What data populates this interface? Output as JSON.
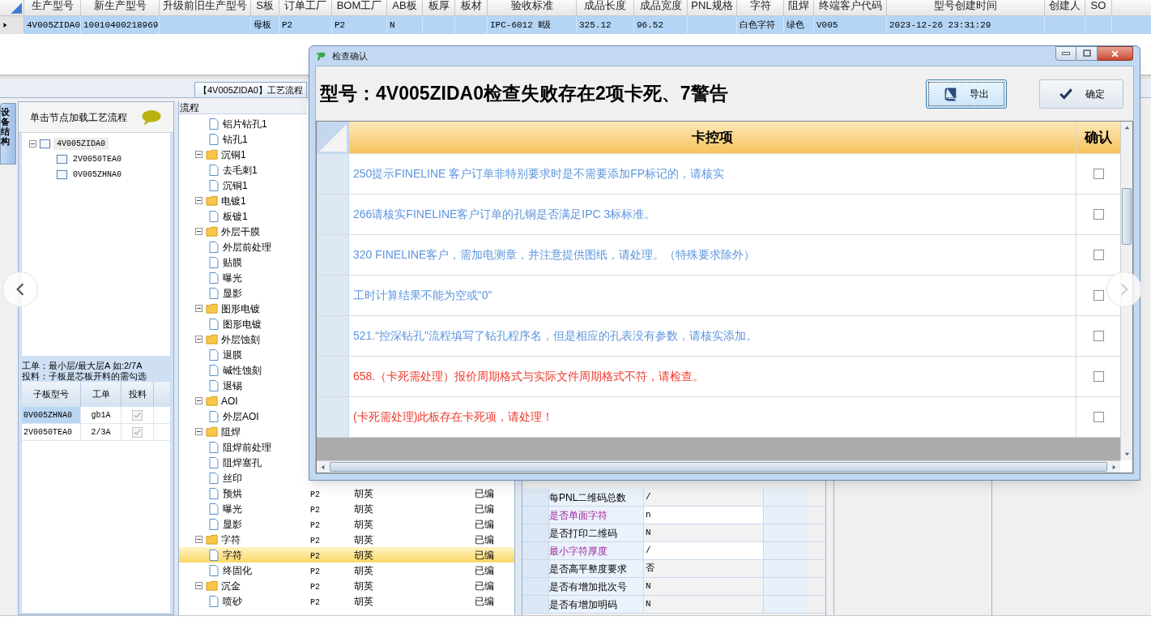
{
  "top_table": {
    "columns": [
      "生产型号",
      "新生产型号",
      "升级前旧生产型号",
      "S板",
      "订单工厂",
      "BOM工厂",
      "AB板",
      "板厚",
      "板材",
      "验收标准",
      "成品长度",
      "成品宽度",
      "PNL规格",
      "字符",
      "阻焊",
      "终端客户代码",
      "型号创建时间",
      "创建人",
      "SO"
    ],
    "rows": [
      {
        "selected": true,
        "cells": [
          "4V005ZIDA0",
          "10010400218969",
          "",
          "母板",
          "P2",
          "P2",
          "N",
          "",
          "",
          "IPC-6012 Ⅱ级",
          "325.12",
          "96.52",
          "",
          "白色字符",
          "绿色",
          "V005",
          "2023-12-26 23:31:29",
          "",
          ""
        ]
      }
    ]
  },
  "document_tab": "【4V005ZIDA0】工艺流程",
  "side_tab": "设备结构",
  "left_panel": {
    "header": "单击节点加载工艺流程",
    "tree": [
      {
        "label": "4V005ZIDA0",
        "expanded": true,
        "children": [
          {
            "label": "2V0050TEA0"
          },
          {
            "label": "0V005ZHNA0"
          }
        ]
      }
    ],
    "note": [
      "工单：最小层/最大层A 如:2/7A",
      "投料：子板是芯板开料的需勾选"
    ],
    "table": {
      "columns": [
        "子板型号",
        "工单",
        "投料"
      ],
      "rows": [
        {
          "selected": true,
          "model": "0V005ZHNA0",
          "order": "gb1A",
          "checked": true
        },
        {
          "selected": false,
          "model": "2V0050TEA0",
          "order": "2/3A",
          "checked": true
        }
      ]
    }
  },
  "flow": {
    "header": "流程",
    "items": [
      {
        "kind": "file",
        "label": "铝片钻孔1"
      },
      {
        "kind": "file",
        "label": "钻孔1"
      },
      {
        "kind": "folder",
        "label": "沉铜1",
        "expanded": true,
        "children": [
          {
            "kind": "file",
            "label": "去毛刺1"
          },
          {
            "kind": "file",
            "label": "沉铜1"
          }
        ]
      },
      {
        "kind": "folder",
        "label": "电镀1",
        "expanded": true,
        "children": [
          {
            "kind": "file",
            "label": "板镀1"
          }
        ]
      },
      {
        "kind": "folder",
        "label": "外层干膜",
        "expanded": true,
        "children": [
          {
            "kind": "file",
            "label": "外层前处理"
          },
          {
            "kind": "file",
            "label": "贴膜"
          },
          {
            "kind": "file",
            "label": "曝光"
          },
          {
            "kind": "file",
            "label": "显影"
          }
        ]
      },
      {
        "kind": "folder",
        "label": "图形电镀",
        "expanded": true,
        "children": [
          {
            "kind": "file",
            "label": "图形电镀"
          }
        ]
      },
      {
        "kind": "folder",
        "label": "外层蚀刻",
        "expanded": true,
        "children": [
          {
            "kind": "file",
            "label": "退膜"
          },
          {
            "kind": "file",
            "label": "碱性蚀刻"
          },
          {
            "kind": "file",
            "label": "退锡"
          }
        ]
      },
      {
        "kind": "folder",
        "label": "AOI",
        "expanded": true,
        "children": [
          {
            "kind": "file",
            "label": "外层AOI"
          }
        ]
      },
      {
        "kind": "folder",
        "label": "阻焊",
        "expanded": true,
        "children": [
          {
            "kind": "file",
            "label": "阻焊前处理"
          },
          {
            "kind": "file",
            "label": "阻焊塞孔"
          },
          {
            "kind": "file",
            "label": "丝印"
          },
          {
            "kind": "file",
            "label": "预烘",
            "factory": "P2",
            "person": "胡英",
            "status": "已编"
          },
          {
            "kind": "file",
            "label": "曝光",
            "factory": "P2",
            "person": "胡英",
            "status": "已编"
          },
          {
            "kind": "file",
            "label": "显影",
            "factory": "P2",
            "person": "胡英",
            "status": "已编"
          }
        ]
      },
      {
        "kind": "folder",
        "label": "字符",
        "expanded": true,
        "factory": "P2",
        "person": "胡英",
        "status": "已编",
        "children": [
          {
            "kind": "file",
            "label": "字符",
            "selected": true,
            "factory": "P2",
            "person": "胡英",
            "status": "已编"
          },
          {
            "kind": "file",
            "label": "终固化",
            "factory": "P2",
            "person": "胡英",
            "status": "已编"
          }
        ]
      },
      {
        "kind": "folder",
        "label": "沉金",
        "expanded": true,
        "factory": "P2",
        "person": "胡英",
        "status": "已编",
        "children": [
          {
            "kind": "file",
            "label": "喷砂",
            "factory": "P2",
            "person": "胡英",
            "status": "已编"
          }
        ]
      }
    ]
  },
  "params": [
    {
      "label": "每PNL二维码总数",
      "value": "/",
      "highlight": false
    },
    {
      "label": "是否单面字符",
      "value": "n",
      "highlight": true
    },
    {
      "label": "是否打印二维码",
      "value": "N",
      "highlight": false
    },
    {
      "label": "最小字符厚度",
      "value": "/",
      "highlight": true
    },
    {
      "label": "是否高平整度要求",
      "value": "否",
      "highlight": false
    },
    {
      "label": "是否有增加批次号",
      "value": "N",
      "highlight": false
    },
    {
      "label": "是否有增加明码",
      "value": "N",
      "highlight": false
    }
  ],
  "dialog": {
    "title": "检查确认",
    "heading": "型号：4V005ZIDA0检查失败存在2项卡死、7警告",
    "buttons": [
      {
        "label": "导出",
        "kind": "export"
      },
      {
        "label": "确定",
        "kind": "ok"
      }
    ],
    "columns": [
      "卡控项",
      "确认"
    ],
    "rows": [
      {
        "kind": "warning",
        "text": "250提示FINELINE 客户订单非特别要求时是不需要添加FP标记的，请核实",
        "checked": false
      },
      {
        "kind": "warning",
        "text": "266请核实FINELINE客户订单的孔铜是否满足IPC 3标标准。",
        "checked": false
      },
      {
        "kind": "warning",
        "text": "320 FINELINE客户，需加电测章，并注意提供图纸，请处理。（特殊要求除外）",
        "checked": false
      },
      {
        "kind": "warning",
        "text": "工时计算结果不能为空或“0”",
        "checked": false
      },
      {
        "kind": "warning",
        "text": "521.“控深钻孔”流程填写了钻孔程序名，但是相应的孔表没有参数，请核实添加。",
        "checked": false
      },
      {
        "kind": "blocking",
        "text": "658.（卡死需处理）报价周期格式与实际文件周期格式不符，请检查。",
        "checked": false
      },
      {
        "kind": "blocking",
        "text": "(卡死需处理)此板存在卡死项，请处理！",
        "checked": false
      }
    ]
  }
}
